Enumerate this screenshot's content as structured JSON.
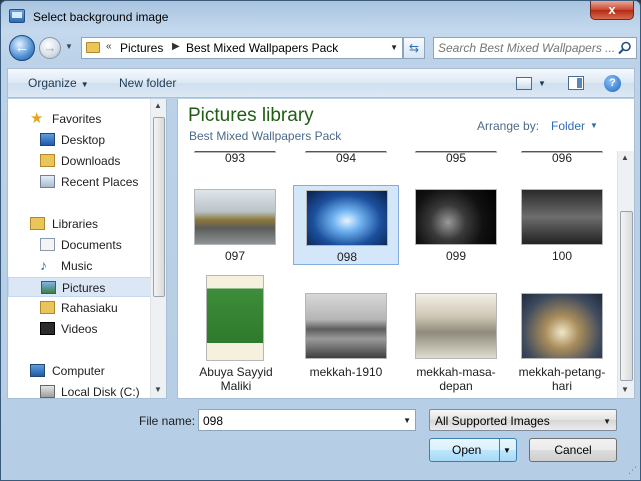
{
  "window": {
    "title": "Select background image",
    "close_glyph": "x"
  },
  "nav": {
    "back_glyph": "←",
    "forward_glyph": "→",
    "breadcrumb_prefix": "«",
    "breadcrumbs": [
      "Pictures",
      "Best Mixed Wallpapers Pack"
    ],
    "search_placeholder": "Search Best Mixed Wallpapers ..."
  },
  "toolbar": {
    "organize": "Organize",
    "new_folder": "New folder",
    "help": "?"
  },
  "sidebar": {
    "items": [
      {
        "label": "Favorites",
        "icon": "star-icon",
        "group": true
      },
      {
        "label": "Desktop",
        "icon": "desktop-icon",
        "group": false
      },
      {
        "label": "Downloads",
        "icon": "downloads-folder-icon",
        "group": false
      },
      {
        "label": "Recent Places",
        "icon": "recent-places-icon",
        "group": false
      },
      {
        "label": "Libraries",
        "icon": "libraries-icon",
        "group": true
      },
      {
        "label": "Documents",
        "icon": "documents-icon",
        "group": false
      },
      {
        "label": "Music",
        "icon": "music-icon",
        "group": false
      },
      {
        "label": "Pictures",
        "icon": "pictures-icon",
        "group": false,
        "selected": true
      },
      {
        "label": "Rahasiaku",
        "icon": "folder-icon",
        "group": false
      },
      {
        "label": "Videos",
        "icon": "videos-icon",
        "group": false
      },
      {
        "label": "Computer",
        "icon": "computer-icon",
        "group": true
      },
      {
        "label": "Local Disk (C:)",
        "icon": "disk-icon",
        "group": false
      }
    ]
  },
  "content": {
    "library_title": "Pictures library",
    "library_subtitle": "Best Mixed Wallpapers Pack",
    "arrange_label": "Arrange by:",
    "arrange_value": "Folder",
    "files": [
      {
        "label": "093",
        "theme": "dark-road"
      },
      {
        "label": "094",
        "theme": "dark-road"
      },
      {
        "label": "095",
        "theme": "dark-road"
      },
      {
        "label": "096",
        "theme": "dark-road"
      },
      {
        "label": "097",
        "theme": "gold-car"
      },
      {
        "label": "098",
        "theme": "blue-car",
        "selected": true
      },
      {
        "label": "099",
        "theme": "black-wheel"
      },
      {
        "label": "100",
        "theme": "bw-car"
      },
      {
        "label": "Abuya Sayyid Maliki",
        "theme": "portrait"
      },
      {
        "label": "mekkah-1910",
        "theme": "mecca-old"
      },
      {
        "label": "mekkah-masa-depan",
        "theme": "mecca-future"
      },
      {
        "label": "mekkah-petang-hari",
        "theme": "mecca-evening"
      }
    ]
  },
  "footer": {
    "file_name_label": "File name:",
    "file_name_value": "098",
    "file_type": "All Supported Images",
    "open_label": "Open",
    "cancel_label": "Cancel"
  },
  "colors": {
    "library_title": "#1e5d12",
    "link": "#2f6cb5",
    "selection": "#d4e6fa"
  }
}
